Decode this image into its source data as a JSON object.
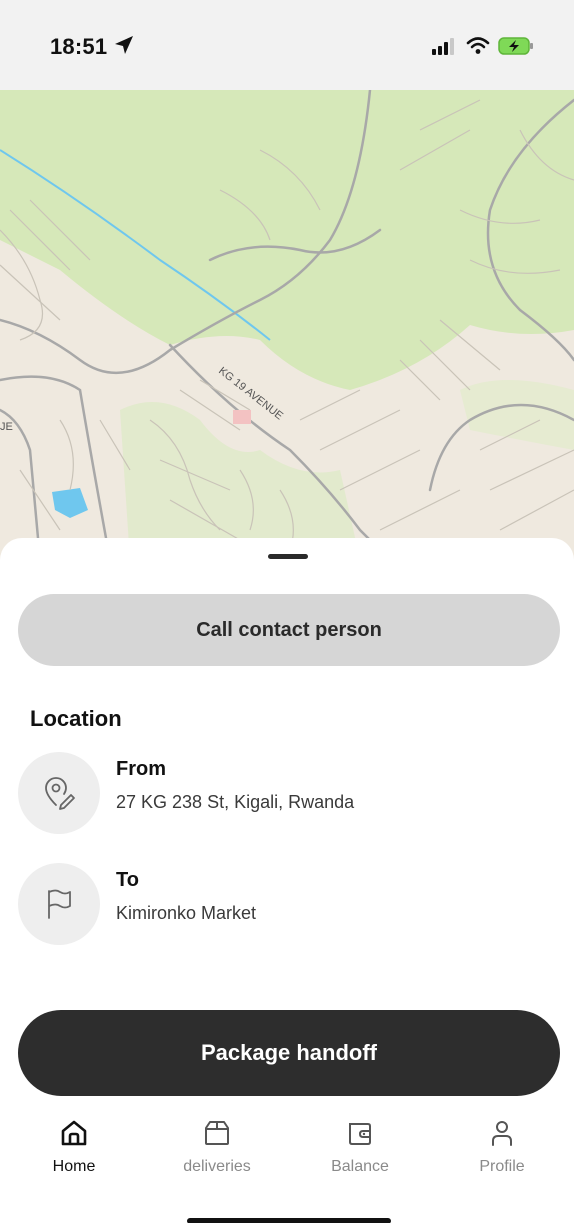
{
  "status_bar": {
    "time": "18:51",
    "icons": [
      "location-arrow-icon",
      "cellular-signal-icon",
      "wifi-icon",
      "battery-charging-icon"
    ]
  },
  "map": {
    "street_labels": [
      "KG 19 AVENUE",
      "JE"
    ]
  },
  "sheet": {
    "call_button_label": "Call contact person",
    "section_title": "Location",
    "from": {
      "label": "From",
      "value": "27 KG 238 St, Kigali, Rwanda",
      "icon": "map-pin-edit-icon"
    },
    "to": {
      "label": "To",
      "value": "Kimironko Market",
      "icon": "flag-icon"
    },
    "handoff_button_label": "Package handoff"
  },
  "tab_bar": {
    "items": [
      {
        "label": "Home",
        "icon": "home-icon",
        "active": true
      },
      {
        "label": "deliveries",
        "icon": "package-icon",
        "active": false
      },
      {
        "label": "Balance",
        "icon": "wallet-icon",
        "active": false
      },
      {
        "label": "Profile",
        "icon": "user-icon",
        "active": false
      }
    ]
  },
  "colors": {
    "primary_button": "#2d2d2d",
    "secondary_button": "#d6d6d6",
    "map_park": "#d6e8b9",
    "map_land": "#efe9df",
    "map_water": "#6fc7ee"
  }
}
